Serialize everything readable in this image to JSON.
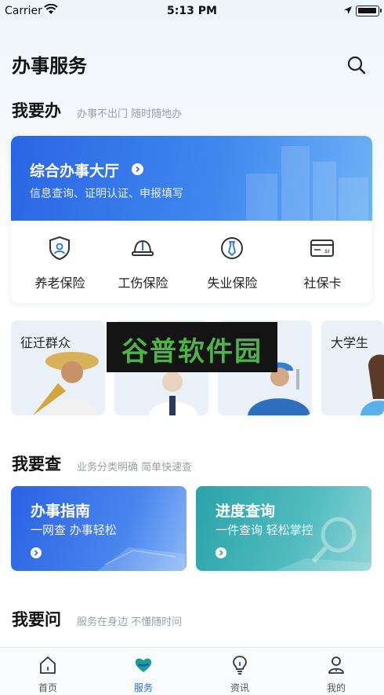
{
  "status_bar": {
    "carrier": "Carrier",
    "time": "5:13 PM"
  },
  "header": {
    "title": "办事服务",
    "search_icon": "search-icon"
  },
  "section_do": {
    "title": "我要办",
    "subtitle": "办事不出门 随时随地办",
    "hall": {
      "title": "综合办事大厅",
      "subtitle": "信息查询、证明认证、申报填写"
    },
    "services": [
      {
        "label": "养老保险",
        "icon": "shield-person-icon"
      },
      {
        "label": "工伤保险",
        "icon": "helmet-icon"
      },
      {
        "label": "失业保险",
        "icon": "tie-badge-icon"
      },
      {
        "label": "社保卡",
        "icon": "card-icon"
      }
    ]
  },
  "people_cards": [
    {
      "label": "征迁群众"
    },
    {
      "label": ""
    },
    {
      "label": ""
    },
    {
      "label": "大学生"
    }
  ],
  "watermark": "谷普软件园",
  "section_check": {
    "title": "我要查",
    "subtitle": "业务分类明确 简单快速查",
    "cards": [
      {
        "title": "办事指南",
        "subtitle": "一网查 办事轻松",
        "color": "#2f68e6"
      },
      {
        "title": "进度查询",
        "subtitle": "一件查询 轻松掌控",
        "color": "#3aaeb0"
      }
    ]
  },
  "section_ask": {
    "title": "我要问",
    "subtitle": "服务在身边 不懂随时问"
  },
  "tabbar": {
    "tabs": [
      {
        "label": "首页",
        "icon": "home-icon"
      },
      {
        "label": "服务",
        "icon": "heart-service-icon",
        "active": true
      },
      {
        "label": "资讯",
        "icon": "lightbulb-icon"
      },
      {
        "label": "我的",
        "icon": "user-icon"
      }
    ],
    "active_color": "#1a6fe0"
  }
}
